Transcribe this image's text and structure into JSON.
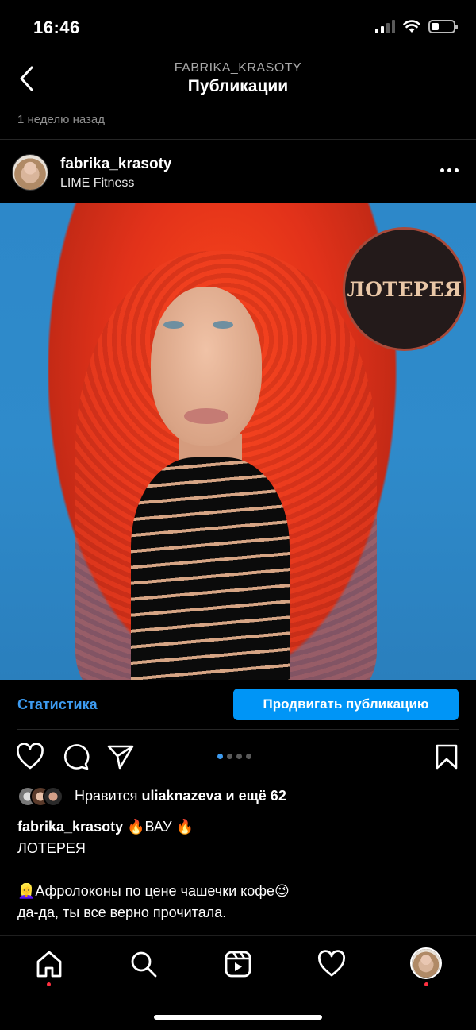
{
  "status_bar": {
    "time": "16:46",
    "battery_level": 0.35,
    "signal_bars": 4,
    "signal_active": 2
  },
  "header": {
    "account": "FABRIKA_KRASOTY",
    "title": "Публикации"
  },
  "time_ago": "1 неделю назад",
  "post": {
    "username": "fabrika_krasoty",
    "location": "LIME Fitness",
    "image_badge": "ЛОТЕРЕЯ",
    "carousel": {
      "count": 4,
      "current": 1
    }
  },
  "insights": {
    "stats_label": "Статистика",
    "promote_label": "Продвигать публикацию"
  },
  "likes": {
    "prefix": "Нравится",
    "user": "uliaknazeva",
    "suffix": "и ещё 62"
  },
  "caption": {
    "username": "fabrika_krasoty",
    "line1": "🔥ВАУ 🔥",
    "line2": "ЛОТЕРЕЯ",
    "line3": "👱‍♀️Афролоконы по цене чашечки кофе😉",
    "line4": "да-да, ты все верно прочитала."
  },
  "nav": {
    "items": [
      "home-icon",
      "search-icon",
      "reels-icon",
      "heart-icon",
      "profile-avatar"
    ]
  },
  "colors": {
    "accent": "#0095f6",
    "link": "#3d9bf0",
    "notification": "#ff3040"
  }
}
